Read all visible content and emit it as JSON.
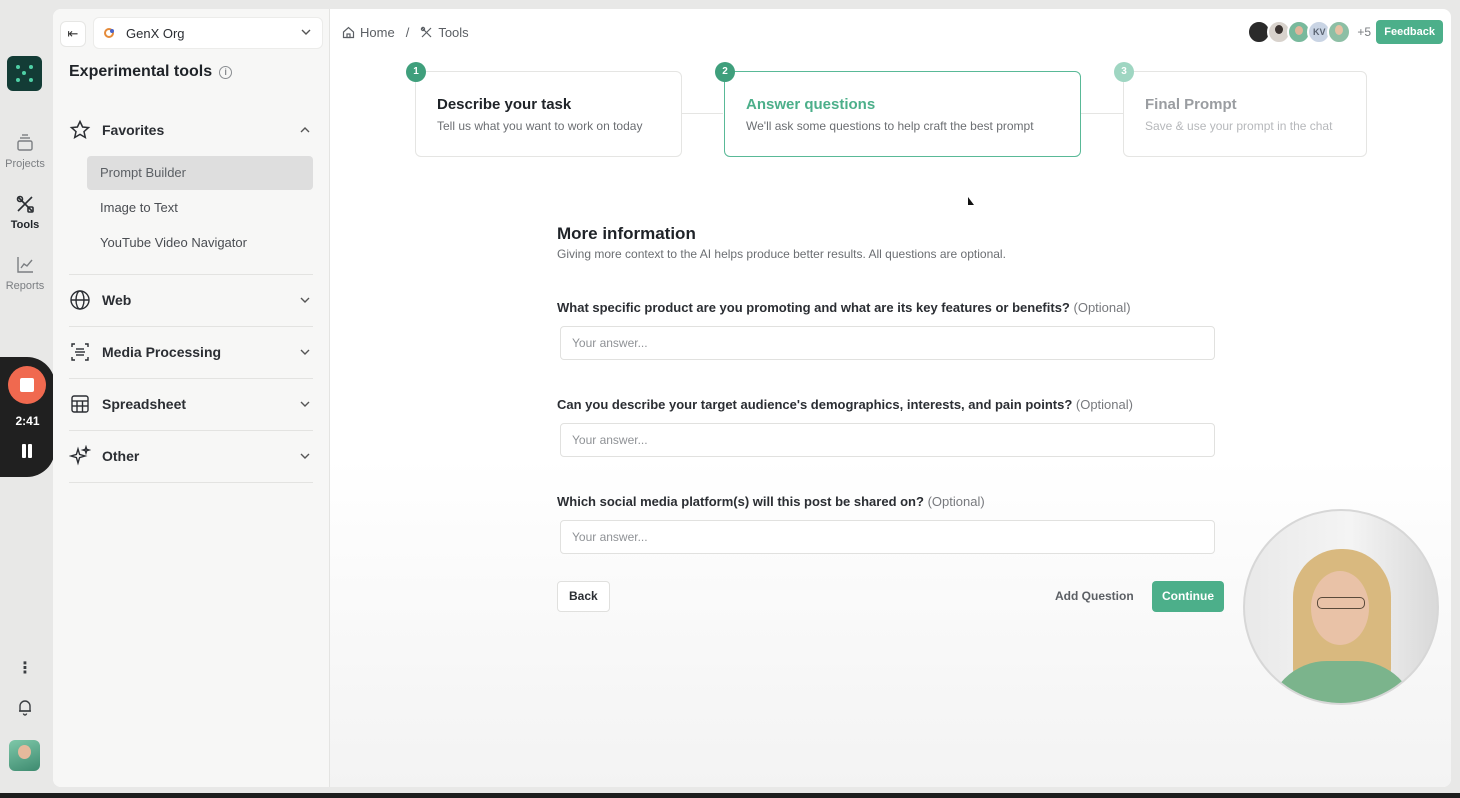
{
  "rail": {
    "projects_label": "Projects",
    "tools_label": "Tools",
    "reports_label": "Reports"
  },
  "recorder": {
    "time": "2:41"
  },
  "panel": {
    "org_name": "GenX Org",
    "title": "Experimental tools",
    "sections": {
      "favorites": "Favorites",
      "web": "Web",
      "media": "Media Processing",
      "spreadsheet": "Spreadsheet",
      "other": "Other"
    },
    "favorites_items": [
      "Prompt Builder",
      "Image to Text",
      "YouTube Video Navigator"
    ]
  },
  "breadcrumb": {
    "home": "Home",
    "sep": "/",
    "tools": "Tools"
  },
  "header": {
    "avatar_initials": "KV",
    "more_count": "+5",
    "feedback_label": "Feedback"
  },
  "steps": [
    {
      "num": "1",
      "title": "Describe your task",
      "desc": "Tell us what you want to work on today"
    },
    {
      "num": "2",
      "title": "Answer questions",
      "desc": "We'll ask some questions to help craft the best prompt"
    },
    {
      "num": "3",
      "title": "Final Prompt",
      "desc": "Save & use your prompt in the chat"
    }
  ],
  "form": {
    "title": "More information",
    "subtitle": "Giving more context to the AI helps produce better results. All questions are optional.",
    "optional_tag": "(Optional)",
    "questions": [
      {
        "text": "What specific product are you promoting and what are its key features or benefits?",
        "placeholder": "Your answer..."
      },
      {
        "text": "Can you describe your target audience's demographics, interests, and pain points?",
        "placeholder": "Your answer..."
      },
      {
        "text": "Which social media platform(s) will this post be shared on?",
        "placeholder": "Your answer..."
      }
    ],
    "back_label": "Back",
    "add_question_label": "Add Question",
    "continue_label": "Continue"
  },
  "colors": {
    "accent": "#4caf8a",
    "rail_logo": "#133c36",
    "record": "#f0694f"
  }
}
